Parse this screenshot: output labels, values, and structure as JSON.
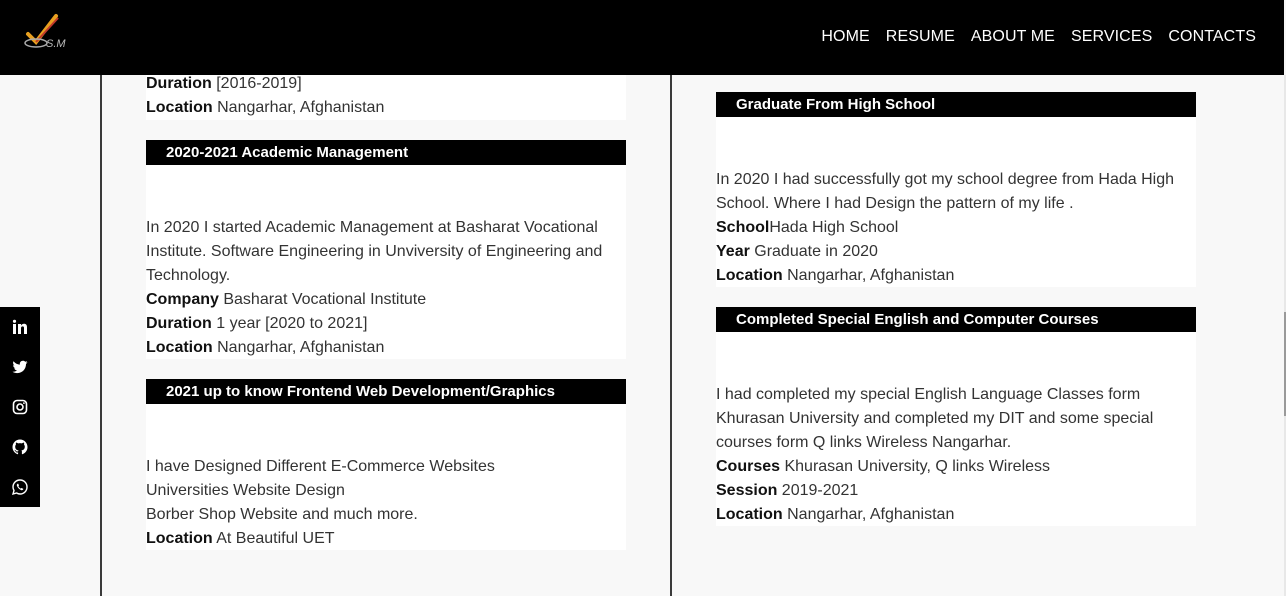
{
  "nav": {
    "logo_text": "S.M",
    "links": [
      "HOME",
      "RESUME",
      "ABOUT ME",
      "SERVICES",
      "CONTACTS"
    ]
  },
  "social": [
    "linkedin-icon",
    "twitter-icon",
    "instagram-icon",
    "github-icon",
    "whatsapp-icon"
  ],
  "left_column": {
    "top_card": {
      "duration_label": "Duration",
      "duration_value": " [2016-2019]",
      "location_label": "Location",
      "location_value": " Nangarhar, Afghanistan"
    },
    "academic": {
      "title": "2020-2021 Academic Management",
      "description": "In 2020 I started Academic Management at Basharat Vocational Institute. Software Engineering in Unviversity of Engineering and Technology.",
      "company_label": "Company",
      "company_value": " Basharat Vocational Institute",
      "duration_label": "Duration",
      "duration_value": " 1 year [2020 to 2021]",
      "location_label": "Location",
      "location_value": " Nangarhar, Afghanistan"
    },
    "frontend": {
      "title": "2021 up to know Frontend Web Development/Graphics",
      "line1": "I have Designed Different E-Commerce Websites",
      "line2": "Universities Website Design",
      "line3": "Borber Shop Website and much more.",
      "location_label": "Location",
      "location_value": " At Beautiful UET"
    }
  },
  "right_column": {
    "school": {
      "title": "Graduate From High School",
      "description": "In 2020 I had successfully got my school degree from Hada High School. Where I had Design the pattern of my life .",
      "school_label": "School",
      "school_value": "Hada High School",
      "year_label": "Year",
      "year_value": " Graduate in 2020",
      "location_label": "Location",
      "location_value": " Nangarhar, Afghanistan"
    },
    "courses": {
      "title": "Completed Special English and Computer Courses",
      "description": "I had completed my special English Language Classes form Khurasan University and completed my DIT and some special courses form Q links Wireless Nangarhar.",
      "courses_label": "Courses",
      "courses_value": " Khurasan University, Q links Wireless",
      "session_label": "Session",
      "session_value": " 2019-2021",
      "location_label": "Location",
      "location_value": " Nangarhar, Afghanistan"
    }
  }
}
